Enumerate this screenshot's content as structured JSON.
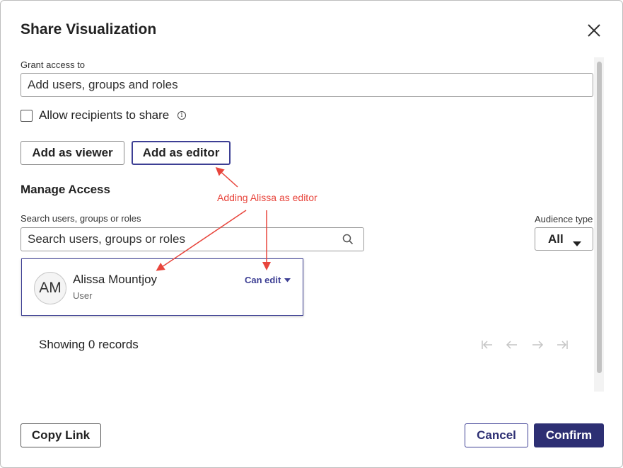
{
  "dialog": {
    "title": "Share Visualization",
    "close_icon": "close-icon"
  },
  "grant": {
    "label": "Grant access to",
    "input_placeholder": "Add users, groups and roles",
    "allow_share_label": "Allow recipients to share",
    "allow_share_checked": false,
    "info_icon": "info-icon"
  },
  "buttons": {
    "add_viewer": "Add as viewer",
    "add_editor": "Add as editor",
    "copy_link": "Copy Link",
    "cancel": "Cancel",
    "confirm": "Confirm"
  },
  "manage": {
    "title": "Manage Access",
    "search_label": "Search users, groups or roles",
    "search_placeholder": "Search users, groups or roles",
    "search_icon": "search-icon",
    "audience_label": "Audience type",
    "audience_value": "All"
  },
  "users": [
    {
      "initials": "AM",
      "name": "Alissa Mountjoy",
      "type": "User",
      "permission": "Can edit"
    }
  ],
  "records_text": "Showing 0 records",
  "pagination_icons": [
    "first-page-icon",
    "prev-page-icon",
    "next-page-icon",
    "last-page-icon"
  ],
  "annotation": {
    "text": "Adding Alissa as editor",
    "color": "#e8453c"
  },
  "colors": {
    "primary": "#2d2f73",
    "accent_border": "#3d3f94"
  }
}
